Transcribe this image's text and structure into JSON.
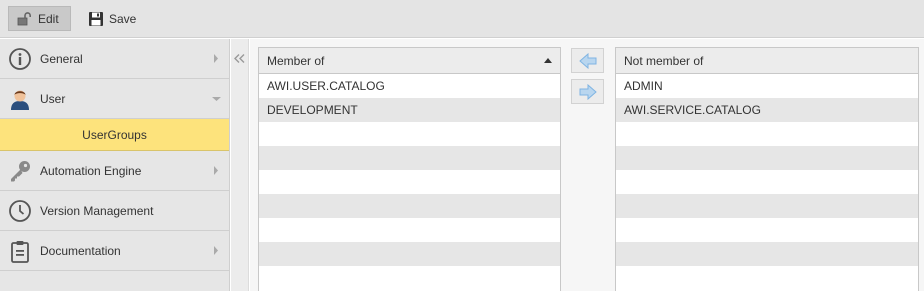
{
  "toolbar": {
    "edit_label": "Edit",
    "save_label": "Save"
  },
  "sidebar": {
    "items": [
      {
        "label": "General",
        "icon": "info-icon",
        "has_arrow": true
      },
      {
        "label": "User",
        "icon": "user-icon",
        "expanded": true
      },
      {
        "label": "Automation Engine",
        "icon": "key-icon",
        "has_arrow": true
      },
      {
        "label": "Version Management",
        "icon": "clock-icon",
        "has_arrow": false
      },
      {
        "label": "Documentation",
        "icon": "clipboard-icon",
        "has_arrow": true
      }
    ],
    "sub_selected": "UserGroups"
  },
  "member_grid": {
    "header": "Member of",
    "rows": [
      "AWI.USER.CATALOG",
      "DEVELOPMENT",
      "",
      "",
      "",
      "",
      "",
      "",
      ""
    ]
  },
  "not_member_grid": {
    "header": "Not member of",
    "rows": [
      "ADMIN",
      "AWI.SERVICE.CATALOG",
      "",
      "",
      "",
      "",
      "",
      "",
      ""
    ]
  },
  "colors": {
    "selected_subitem": "#fde37c",
    "toolbar_bg": "#e4e4e4",
    "arrow_button_blue": "#7fb4e3"
  }
}
